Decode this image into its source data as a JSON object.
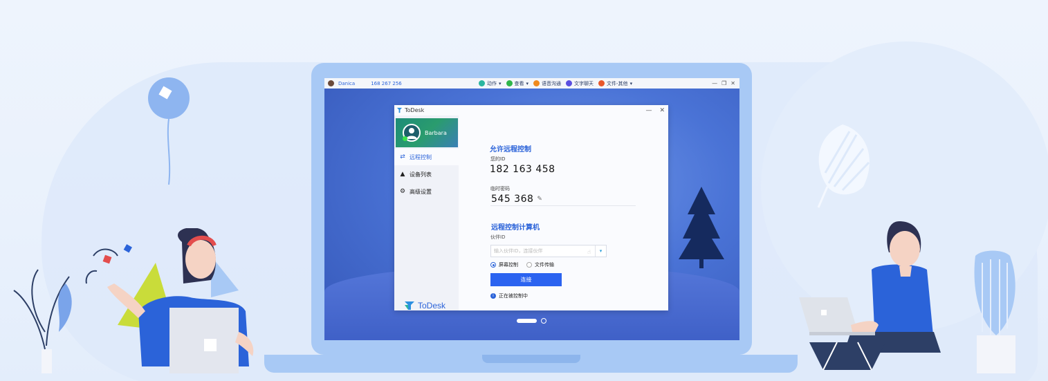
{
  "remote_toolbar": {
    "user_name": "Danica",
    "device_id": "168 267 256",
    "tools": [
      {
        "label": "动作",
        "icon": "action-icon",
        "color": "#2bb5a0",
        "has_dropdown": true
      },
      {
        "label": "查看",
        "icon": "view-icon",
        "color": "#2fb54a",
        "has_dropdown": true
      },
      {
        "label": "语音沟通",
        "icon": "voice-icon",
        "color": "#f08a1e",
        "has_dropdown": false
      },
      {
        "label": "文字聊天",
        "icon": "chat-icon",
        "color": "#5b4fe0",
        "has_dropdown": false
      },
      {
        "label": "文件-其他",
        "icon": "file-icon",
        "color": "#e8582c",
        "has_dropdown": true
      }
    ],
    "dropdown_glyph": "▾",
    "window_controls": [
      "—",
      "❐",
      "✕"
    ]
  },
  "todesk": {
    "title": "ToDesk",
    "window_controls": [
      "—",
      "✕"
    ],
    "profile_name": "Barbara",
    "nav": [
      {
        "label": "远程控制",
        "icon": "swap-arrows-icon",
        "glyph": "⇄",
        "active": true
      },
      {
        "label": "设备列表",
        "icon": "devices-icon",
        "glyph": "▲",
        "active": false
      },
      {
        "label": "高级设置",
        "icon": "gear-icon",
        "glyph": "⚙",
        "active": false
      }
    ],
    "brand": "ToDesk",
    "allow_section": {
      "heading": "允许远程控制",
      "id_label": "您的ID",
      "id_value": "182 163 458",
      "password_label": "临时密码",
      "password_value": "545 368",
      "edit_glyph": "✎"
    },
    "control_section": {
      "heading": "远程控制计算机",
      "partner_label": "伙伴ID",
      "partner_placeholder": "输入伙伴ID，连接伙伴",
      "hand_glyph": "☝",
      "dropdown_glyph": "▾",
      "mode_options": [
        {
          "label": "屏幕控制",
          "selected": true
        },
        {
          "label": "文件传输",
          "selected": false
        }
      ],
      "connect_label": "连接",
      "status_text": "正在被控制中",
      "status_glyph": "i"
    }
  },
  "colors": {
    "accent": "#2b63d9",
    "button": "#2b63f0",
    "laptop": "#a8c9f5"
  }
}
